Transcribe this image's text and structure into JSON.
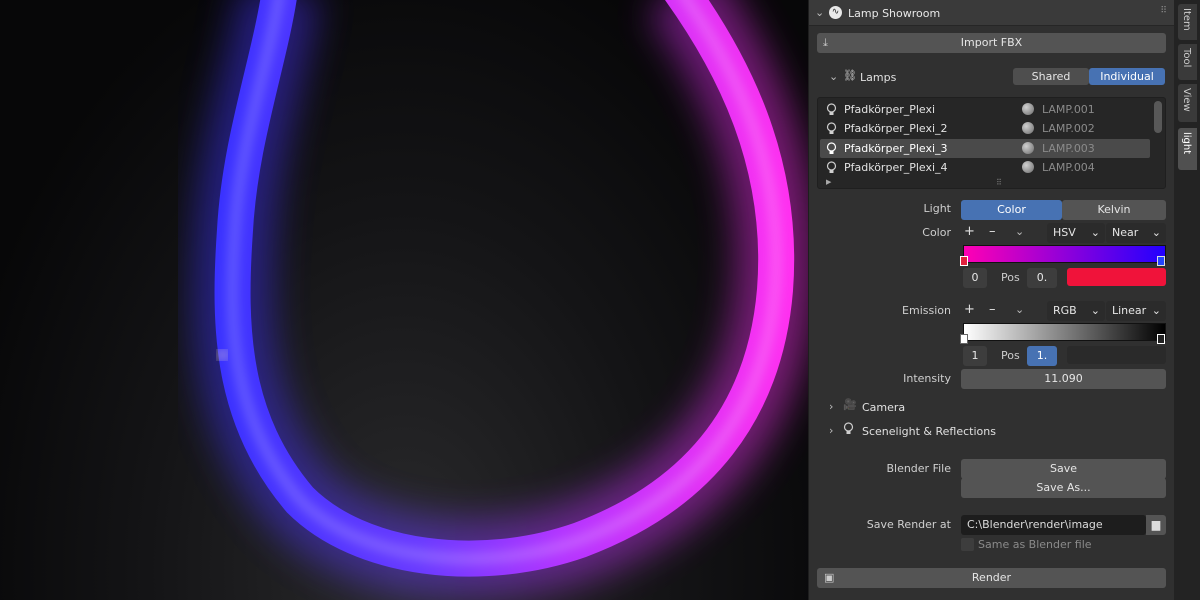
{
  "panel": {
    "title": "Lamp Showroom",
    "import_label": "Import FBX",
    "lamps": {
      "label": "Lamps",
      "mode_shared": "Shared",
      "mode_individual": "Individual",
      "items": [
        {
          "name": "Pfadkörper_Plexi",
          "material": "LAMP.001"
        },
        {
          "name": "Pfadkörper_Plexi_2",
          "material": "LAMP.002"
        },
        {
          "name": "Pfadkörper_Plexi_3",
          "material": "LAMP.003"
        },
        {
          "name": "Pfadkörper_Plexi_4",
          "material": "LAMP.004"
        }
      ]
    },
    "light": {
      "label": "Light",
      "opt_color": "Color",
      "opt_kelvin": "Kelvin"
    },
    "color": {
      "label": "Color",
      "plus": "+",
      "minus": "–",
      "mode": "HSV",
      "interp": "Near",
      "index": "0",
      "pos_label": "Pos",
      "pos_value": "0.",
      "stop_color": "#f0133a",
      "grad_start": "#ff00b4",
      "grad_end": "#2200ff"
    },
    "emission": {
      "label": "Emission",
      "plus": "+",
      "minus": "–",
      "mode": "RGB",
      "interp": "Linear",
      "index": "1",
      "pos_label": "Pos",
      "pos_value": "1."
    },
    "intensity": {
      "label": "Intensity",
      "value": "11.090"
    },
    "sections": {
      "camera": "Camera",
      "scenelight": "Scenelight & Reflections"
    },
    "file": {
      "label": "Blender File",
      "save": "Save",
      "save_as": "Save As..."
    },
    "render_at": {
      "label": "Save Render at",
      "path": "C:\\Blender\\render\\image",
      "same_as": "Same as Blender file"
    },
    "render_label": "Render"
  },
  "side_tabs": [
    "Item",
    "Tool",
    "View",
    "light"
  ],
  "glow": {
    "blue": "#4a37ff",
    "pink": "#ff2cf2"
  }
}
